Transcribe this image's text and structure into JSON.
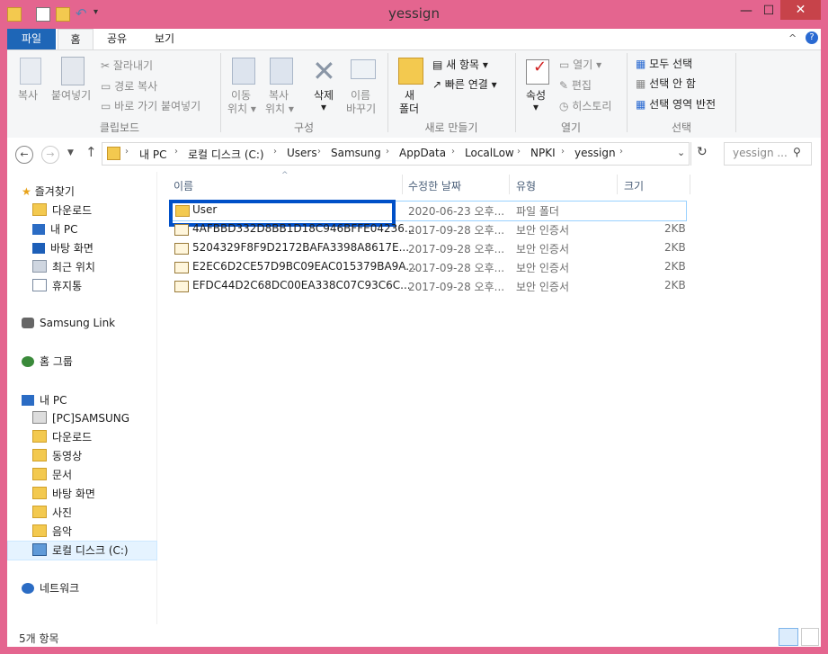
{
  "window": {
    "title": "yessign"
  },
  "tabs": [
    "파일",
    "홈",
    "공유",
    "보기"
  ],
  "ribbon": {
    "clipboard": {
      "copy": "복사",
      "paste": "붙여넣기",
      "cut": "잘라내기",
      "copy_path": "경로 복사",
      "paste_shortcut": "바로 가기 붙여넣기",
      "group": "클립보드"
    },
    "organize": {
      "move_to": "이동",
      "move_to2": "위치",
      "copy_to": "복사",
      "copy_to2": "위치",
      "delete": "삭제",
      "rename": "이름",
      "rename2": "바꾸기",
      "group": "구성"
    },
    "new": {
      "new_folder": "새",
      "new_folder2": "폴더",
      "new_item": "새 항목",
      "easy_access": "빠른 연결",
      "group": "새로 만들기"
    },
    "open": {
      "properties": "속성",
      "open": "열기",
      "edit": "편집",
      "history": "히스토리",
      "group": "열기"
    },
    "select": {
      "select_all": "모두 선택",
      "select_none": "선택 안 함",
      "invert": "선택 영역 반전",
      "group": "선택"
    }
  },
  "address": {
    "crumbs": [
      "내 PC",
      "로컬 디스크 (C:)",
      "Users",
      "Samsung",
      "AppData",
      "LocalLow",
      "NPKI",
      "yessign"
    ],
    "search_placeholder": "yessign ..."
  },
  "nav": {
    "favorites": "즐겨찾기",
    "fav_items": [
      "다운로드",
      "내 PC",
      "바탕 화면",
      "최근 위치",
      "휴지통"
    ],
    "samsung_link": "Samsung Link",
    "homegroup": "홈 그룹",
    "this_pc": "내 PC",
    "pc_items": [
      "[PC]SAMSUNG",
      "다운로드",
      "동영상",
      "문서",
      "바탕 화면",
      "사진",
      "음악",
      "로컬 디스크 (C:)"
    ],
    "network": "네트워크"
  },
  "columns": {
    "name": "이름",
    "date": "수정한 날짜",
    "type": "유형",
    "size": "크기"
  },
  "files": [
    {
      "name": "User",
      "date": "2020-06-23 오후...",
      "type": "파일 폴더",
      "size": ""
    },
    {
      "name": "4AFBBD332D8BB1D18C946BFFE04236...",
      "date": "2017-09-28 오후...",
      "type": "보안 인증서",
      "size": "2KB"
    },
    {
      "name": "5204329F8F9D2172BAFA3398A8617E...",
      "date": "2017-09-28 오후...",
      "type": "보안 인증서",
      "size": "2KB"
    },
    {
      "name": "E2EC6D2CE57D9BC09EAC015379BA9A...",
      "date": "2017-09-28 오후...",
      "type": "보안 인증서",
      "size": "2KB"
    },
    {
      "name": "EFDC44D2C68DC00EA338C07C93C6C...",
      "date": "2017-09-28 오후...",
      "type": "보안 인증서",
      "size": "2KB"
    }
  ],
  "status": {
    "count": "5개 항목"
  }
}
